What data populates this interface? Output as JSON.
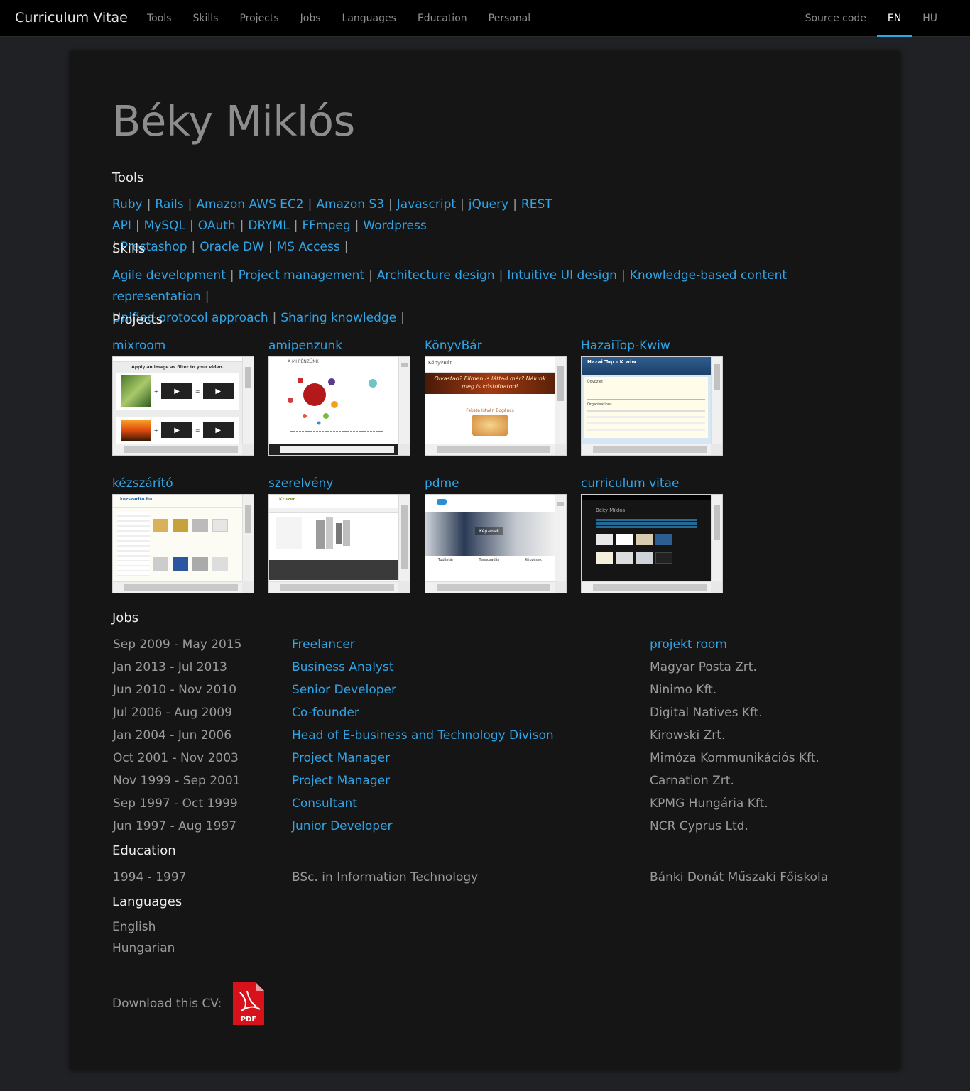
{
  "navbar": {
    "brand": "Curriculum Vitae",
    "left_items": [
      "Tools",
      "Skills",
      "Projects",
      "Jobs",
      "Languages",
      "Education",
      "Personal"
    ],
    "right_items": [
      "Source code",
      "EN",
      "HU"
    ],
    "active": "EN"
  },
  "name": "Béky Miklós",
  "tools": {
    "title": "Tools",
    "items": [
      "Ruby",
      "Rails",
      "Amazon AWS EC2",
      "Amazon S3",
      "Javascript",
      "jQuery",
      "REST API",
      "MySQL",
      "OAuth",
      "DRYML",
      "FFmpeg",
      "Wordpress",
      "Prestashop",
      "Oracle DW",
      "MS Access"
    ]
  },
  "skills": {
    "title": "Skills",
    "items": [
      "Agile development",
      "Project management",
      "Architecture design",
      "Intuitive UI design",
      "Knowledge-based content representation",
      "Unified protocol approach",
      "Sharing knowledge"
    ]
  },
  "projects": {
    "title": "Projects",
    "items": [
      "mixroom",
      "amipenzunk",
      "KönyvBár",
      "HazaiTop-Kwiw",
      "kézszárító",
      "szerelvény",
      "pdme",
      "curriculum vitae"
    ],
    "thumb_texts": {
      "mixroom": "Apply an image as filter to your video.",
      "amipenzunk": "A MI PÉNZÜNK",
      "konyvbar": "Olvastad? Filmen is láttad már? Nálunk meg is kóstolhatod!",
      "konyvbar_sub": "Fekete István Bogáncs",
      "hazaitop": "Hazai Top - K wiw",
      "hazaitop_sub1": "Üdvözlet",
      "hazaitop_sub2": "Organisations",
      "kezszarito": "kezszarito.hu",
      "szerelveny": "Kruzer",
      "pdme": "Képzések",
      "pdme_cols": [
        "Tudástár",
        "Tanácsadás",
        "Képzések"
      ],
      "cv": "Béky Miklós"
    }
  },
  "jobs": {
    "title": "Jobs",
    "rows": [
      {
        "period": "Sep 2009 - May 2015",
        "role": "Freelancer",
        "company": "projekt room",
        "company_link": true
      },
      {
        "period": "Jan 2013 - Jul 2013",
        "role": "Business Analyst",
        "company": "Magyar Posta Zrt.",
        "company_link": false
      },
      {
        "period": "Jun 2010 - Nov 2010",
        "role": "Senior Developer",
        "company": "Ninimo Kft.",
        "company_link": false
      },
      {
        "period": "Jul 2006 - Aug 2009",
        "role": "Co-founder",
        "company": "Digital Natives Kft.",
        "company_link": false
      },
      {
        "period": "Jan 2004 - Jun 2006",
        "role": "Head of E-business and Technology Divison",
        "company": "Kirowski Zrt.",
        "company_link": false
      },
      {
        "period": "Oct 2001 - Nov 2003",
        "role": "Project Manager",
        "company": "Mimóza Kommunikációs Kft.",
        "company_link": false
      },
      {
        "period": "Nov 1999 - Sep 2001",
        "role": "Project Manager",
        "company": "Carnation Zrt.",
        "company_link": false
      },
      {
        "period": "Sep 1997 - Oct 1999",
        "role": "Consultant",
        "company": "KPMG Hungária Kft.",
        "company_link": false
      },
      {
        "period": "Jun 1997 - Aug 1997",
        "role": "Junior Developer",
        "company": "NCR Cyprus Ltd.",
        "company_link": false
      }
    ]
  },
  "education": {
    "title": "Education",
    "rows": [
      {
        "period": "1994 - 1997",
        "degree": "BSc. in Information Technology",
        "school": "Bánki Donát Műszaki Főiskola"
      }
    ]
  },
  "languages": {
    "title": "Languages",
    "items": [
      "English",
      "Hungarian"
    ]
  },
  "download": {
    "label": "Download this CV:",
    "icon_text": "PDF"
  },
  "colors": {
    "link": "#2fa4e7",
    "background": "#1f2124",
    "panel": "#151515",
    "text": "#9a9a9a",
    "heading": "#ececec",
    "pdf_red": "#d7121b"
  }
}
